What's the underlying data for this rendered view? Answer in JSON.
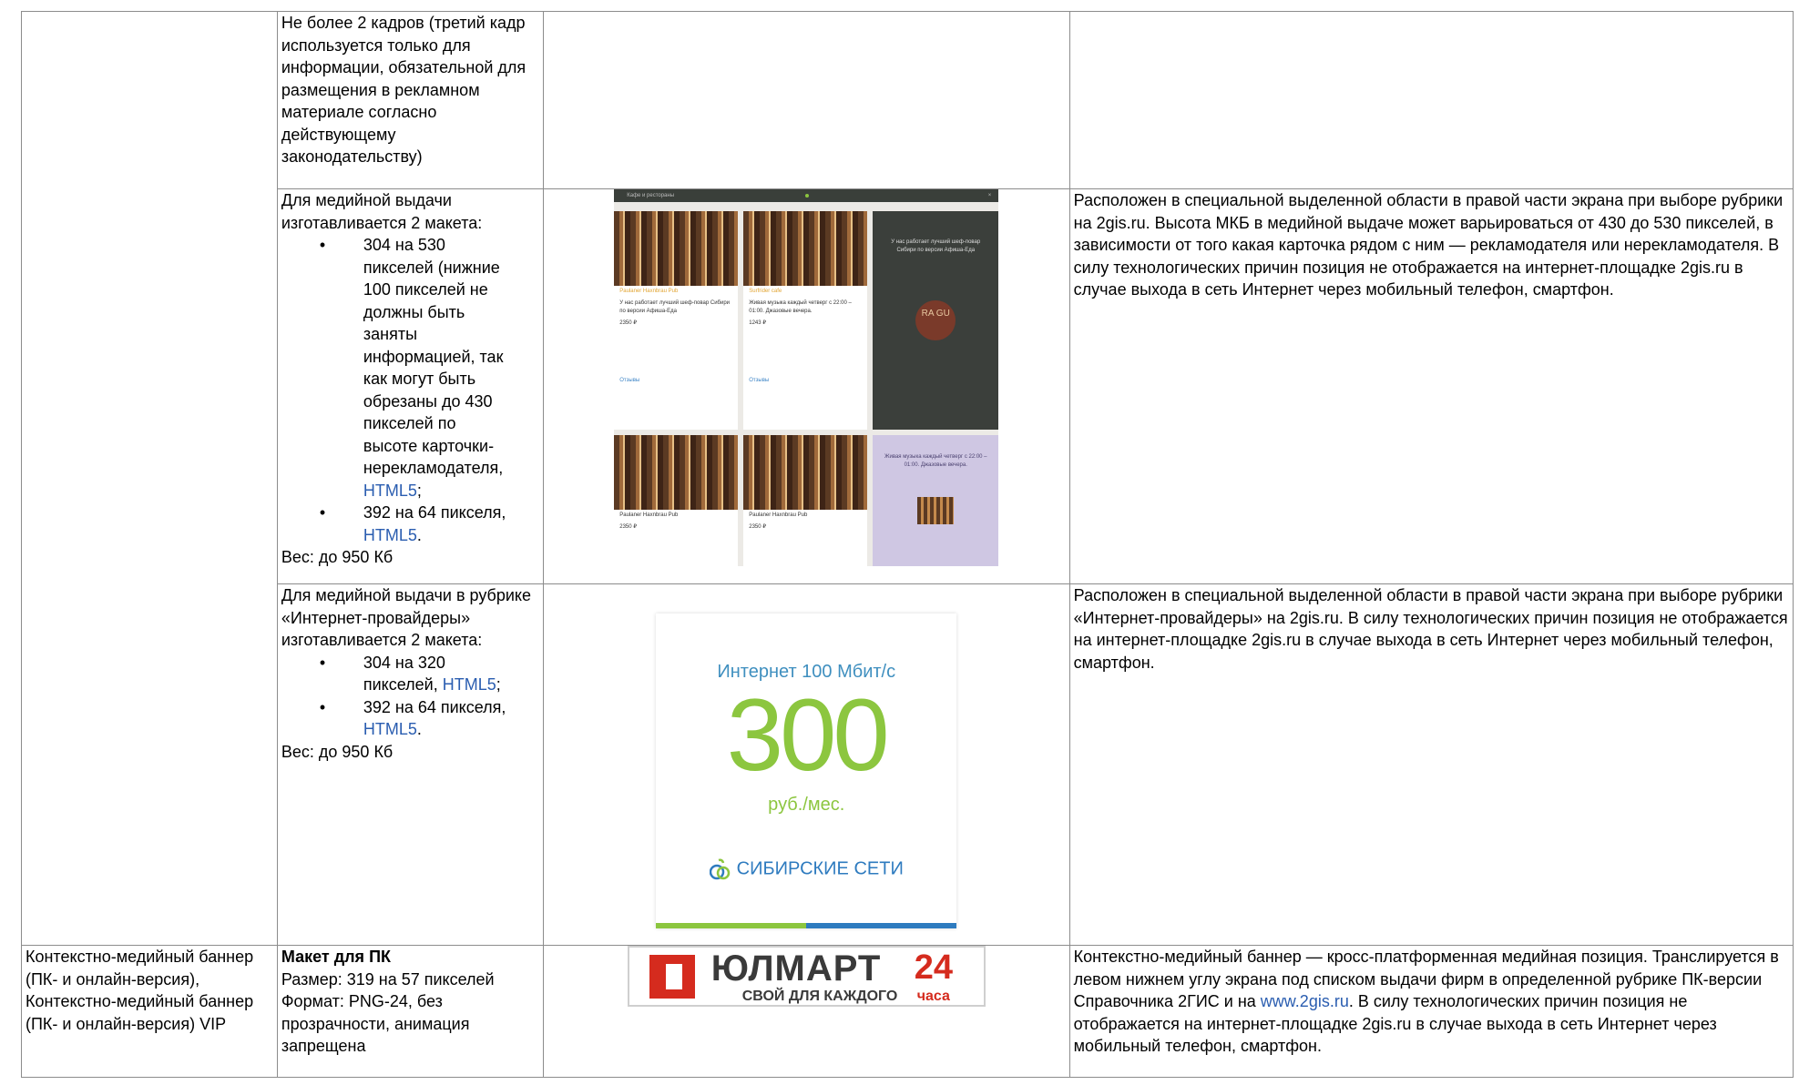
{
  "row0": {
    "col2": "Не более 2 кадров (третий кадр используется только для информации, обязательной для размещения в рекламном материале согласно действующему законодательству)"
  },
  "row1": {
    "intro": "Для медийной выдачи изготавливается 2 макета:",
    "item1_text": "304 на 530 пикселей (нижние 100 пикселей не должны быть заняты информацией, так как могут быть обрезаны до 430 пикселей по высоте карточки-нерекламодателя,",
    "item1_link": "HTML5",
    "item1_suffix": ";",
    "item2_text": "392 на 64 пикселя,",
    "item2_link": "HTML5",
    "item2_suffix": ".",
    "weight": "Вес: до 950 Кб",
    "description": "Расположен в специальной выделенной области в правой части экрана при выборе рубрики на 2gis.ru. Высота МКБ в медийной выдаче может варьироваться от 430 до 530 пикселей, в зависимости от того какая карточка рядом с ним — рекламодателя или нерекламодателя. В силу технологических причин позиция не отображается на интернет-площадке 2gis.ru в случае выхода в сеть Интернет через мобильный телефон, смартфон.",
    "mock": {
      "bar_title": "Кафе и рестораны",
      "close": "×",
      "card1_title": "Paulaner Haxnbrau Pub",
      "card1_line": "У нас работает лучший шеф-повар Сибири по версии Афиша-Еда",
      "card1_price": "2350 ₽",
      "card1_link": "Отзывы",
      "card2_title": "Surfrider cafe",
      "card2_line": "Живая музыка каждый четверг с 22:00 – 01:00. Джазовые вечера.",
      "card2_price": "1243 ₽",
      "card2_link": "Отзывы",
      "promo1_text": "У нас работает лучший шеф-повар Сибири по версии Афиша-Еда",
      "promo1_logo": "RA GU",
      "promo2_text": "Живая музыка каждый четверг с 22:00 – 01:00. Джазовые вечера.",
      "card3_title": "Paulaner Haxnbrau Pub",
      "card3_price": "2350 ₽",
      "card4_title": "Paulaner Haxnbrau Pub",
      "card4_price": "2350 ₽"
    }
  },
  "row2": {
    "intro": "Для медийной выдачи в рубрике «Интернет-провайдеры» изготавливается 2 макета:",
    "item1_text": "304 на 320 пикселей,",
    "item1_link": "HTML5",
    "item1_suffix": ";",
    "item2_text": "392 на 64 пикселя,",
    "item2_link": "HTML5",
    "item2_suffix": ".",
    "weight": "Вес: до 950 Кб",
    "description": "Расположен в специальной выделенной области в правой части экрана при выборе рубрики «Интернет-провайдеры» на 2gis.ru. В силу технологических причин позиция не отображается на интернет-площадке 2gis.ru в случае выхода в сеть Интернет через мобильный телефон, смартфон.",
    "banner": {
      "headline": "Интернет 100 Мбит/с",
      "big_number": "300",
      "unit": "руб./мес.",
      "brand": "СИБИРСКИЕ СЕТИ"
    }
  },
  "row3": {
    "col1": "Контекстно-медийный баннер (ПК- и онлайн-версия), Контекстно-медийный баннер (ПК- и онлайн-версия) VIP",
    "title": "Макет для ПК",
    "size": "Размер: 319 на 57 пикселей",
    "format": "Формат: PNG-24, без прозрачности, анимация запрещена",
    "desc_part1": "Контекстно-медийный баннер — кросс-платформенная медийная позиция. Транслируется в левом нижнем углу экрана под списком выдачи фирм в определенной рубрике ПК-версии Справочника 2ГИС и на",
    "desc_link": "www.2gis.ru",
    "desc_part2": ". В силу технологических причин позиция не отображается на интернет-площадке 2gis.ru в случае выхода в сеть Интернет через мобильный телефон, смартфон.",
    "banner": {
      "word": "ЮЛМАРТ",
      "sub": "СВОЙ ДЛЯ КАЖДОГО",
      "num": "24",
      "chasa": "часа"
    }
  },
  "colors": {
    "link": "#2a5db0",
    "border": "#8c8c8c",
    "green": "#8cc63f",
    "blue": "#2e7bbf",
    "red": "#d52b1e"
  }
}
